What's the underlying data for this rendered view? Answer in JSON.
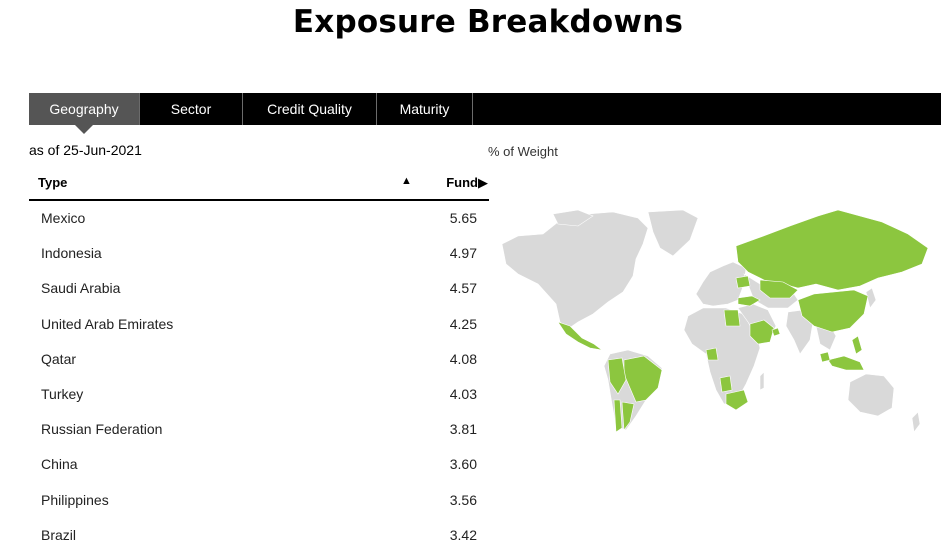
{
  "page": {
    "title": "Exposure Breakdowns"
  },
  "tabs": [
    {
      "label": "Geography",
      "active": true
    },
    {
      "label": "Sector",
      "active": false
    },
    {
      "label": "Credit Quality",
      "active": false
    },
    {
      "label": "Maturity",
      "active": false
    }
  ],
  "as_of": "as of 25-Jun-2021",
  "map_label": "% of Weight",
  "table": {
    "col_type": "Type",
    "sort_icon": "▲",
    "col_fund": "Fund▶",
    "rows": [
      {
        "name": "Mexico",
        "value": "5.65"
      },
      {
        "name": "Indonesia",
        "value": "4.97"
      },
      {
        "name": "Saudi Arabia",
        "value": "4.57"
      },
      {
        "name": "United Arab Emirates",
        "value": "4.25"
      },
      {
        "name": "Qatar",
        "value": "4.08"
      },
      {
        "name": "Turkey",
        "value": "4.03"
      },
      {
        "name": "Russian Federation",
        "value": "3.81"
      },
      {
        "name": "China",
        "value": "3.60"
      },
      {
        "name": "Philippines",
        "value": "3.56"
      },
      {
        "name": "Brazil",
        "value": "3.42"
      }
    ]
  },
  "colors": {
    "highlight": "#8cc63f",
    "land": "#d9d9d9",
    "tab_bar": "#000000",
    "tab_active": "#555555"
  }
}
